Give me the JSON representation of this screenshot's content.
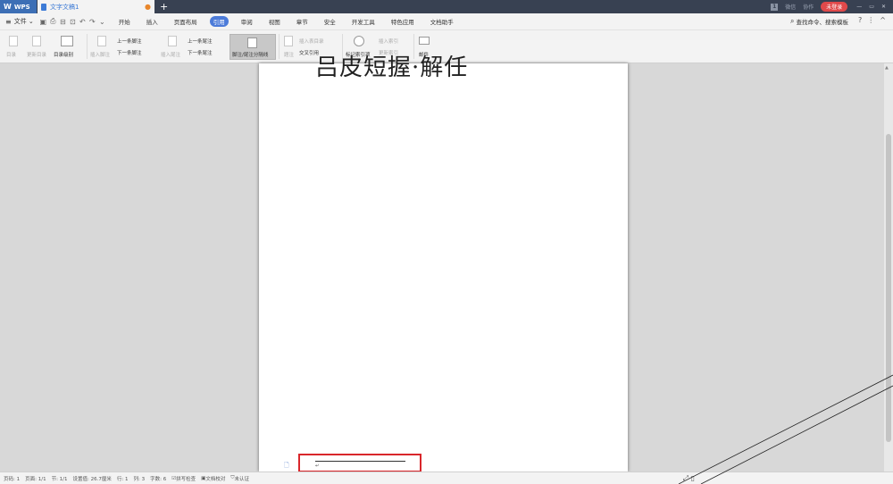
{
  "titlebar": {
    "app_tab": "WPS",
    "doc_tab": "文字文稿1",
    "new_tab": "+",
    "right_items": [
      "1",
      "微信",
      "协作"
    ],
    "login": "未登录",
    "window_controls": [
      "—",
      "▭",
      "✕"
    ]
  },
  "menubar": {
    "file": "文件",
    "items": [
      "开始",
      "插入",
      "页面布局",
      "引用",
      "审阅",
      "视图",
      "章节",
      "安全",
      "开发工具",
      "特色应用",
      "文档助手"
    ],
    "active_index": 3,
    "search": "查找命令、搜索模板",
    "right_icons": [
      "?",
      "⋮",
      "^"
    ]
  },
  "ribbon": {
    "toc": "目录",
    "update_toc": "更新目录",
    "toc_level": "目录级别",
    "insert_footnote": "插入脚注",
    "prev_footnote": "上一条脚注",
    "next_footnote": "下一条脚注",
    "insert_endnote": "插入尾注",
    "prev_endnote": "上一条尾注",
    "next_endnote": "下一条尾注",
    "separator": "脚注/尾注分隔线",
    "caption": "题注",
    "insert_table_of_figures": "插入表目录",
    "cross_reference": "交叉引用",
    "mark_index": "标记索引项",
    "insert_index": "插入索引",
    "update_index": "更新索引",
    "mail": "邮件"
  },
  "document": {
    "heading": "吕皮短握·解任",
    "footnote_mark": "↵"
  },
  "statusbar": {
    "page": "页码: 1",
    "pages": "页面: 1/1",
    "section": "节: 1/1",
    "setting": "设置值: 26.7厘米",
    "row": "行: 1",
    "col": "列: 3",
    "words": "字数: 6",
    "spell": "拼写检查",
    "proof": "文档校对",
    "cert": "未认证"
  },
  "colors": {
    "accent": "#4c7bd9",
    "titlebar": "#384152",
    "highlight_box": "#d9262b",
    "login": "#e0494a"
  }
}
